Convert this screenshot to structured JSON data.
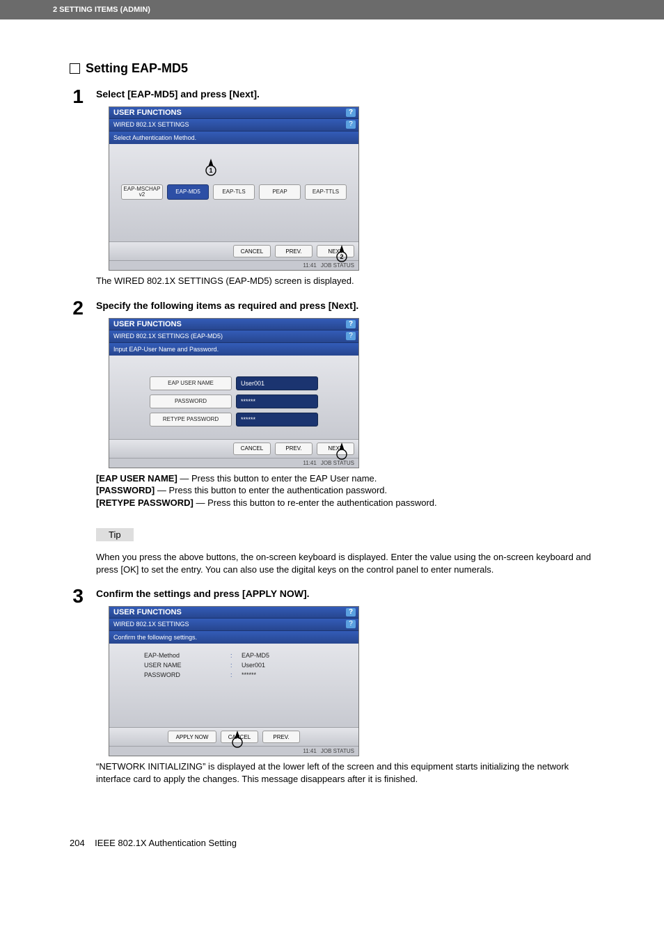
{
  "header": {
    "breadcrumb": "2 SETTING ITEMS (ADMIN)"
  },
  "section": {
    "title": "Setting EAP-MD5"
  },
  "step1": {
    "instruction": "Select [EAP-MD5] and press [Next].",
    "screenshot": {
      "titlebar": "USER FUNCTIONS",
      "subtitle": "WIRED 802.1X SETTINGS",
      "prompt": "Select Authentication Method.",
      "methods": [
        "EAP-MSCHAP v2",
        "EAP-MD5",
        "EAP-TLS",
        "PEAP",
        "EAP-TTLS"
      ],
      "selected_method": "EAP-MD5",
      "cancel": "CANCEL",
      "prev": "PREV.",
      "next": "NEXT",
      "time": "11:41",
      "jobstatus": "JOB STATUS",
      "pointer1_label": "1",
      "pointer2_label": "2"
    },
    "after": "The WIRED 802.1X SETTINGS (EAP-MD5) screen is displayed."
  },
  "step2": {
    "instruction": "Specify the following items as required and press [Next].",
    "screenshot": {
      "titlebar": "USER FUNCTIONS",
      "subtitle": "WIRED 802.1X SETTINGS (EAP-MD5)",
      "prompt": "Input EAP-User Name and Password.",
      "field_user_label": "EAP USER NAME",
      "field_user_value": "User001",
      "field_pass_label": "PASSWORD",
      "field_pass_value": "******",
      "field_repass_label": "RETYPE PASSWORD",
      "field_repass_value": "******",
      "cancel": "CANCEL",
      "prev": "PREV.",
      "next": "NEXT",
      "time": "11:41",
      "jobstatus": "JOB STATUS"
    },
    "desc": {
      "eapuser_label": "[EAP USER NAME]",
      "eapuser_text": " — Press this button to enter the EAP User name.",
      "password_label": "[PASSWORD]",
      "password_text": " — Press this button to enter the authentication password.",
      "repassword_label": "[RETYPE PASSWORD]",
      "repassword_text": " — Press this button to re-enter the authentication password."
    },
    "tip_label": "Tip",
    "tip_text": "When you press the above buttons, the on-screen keyboard is displayed. Enter the value using the on-screen keyboard and press [OK] to set the entry. You can also use the digital keys on the control panel to enter numerals."
  },
  "step3": {
    "instruction": "Confirm the settings and press [APPLY NOW].",
    "screenshot": {
      "titlebar": "USER FUNCTIONS",
      "subtitle": "WIRED 802.1X SETTINGS",
      "prompt": "Confirm the following settings.",
      "row1_label": "EAP-Method",
      "row1_value": "EAP-MD5",
      "row2_label": "USER NAME",
      "row2_value": "User001",
      "row3_label": "PASSWORD",
      "row3_value": "******",
      "apply": "APPLY NOW",
      "cancel": "CANCEL",
      "prev": "PREV.",
      "time": "11:41",
      "jobstatus": "JOB STATUS"
    },
    "after": "“NETWORK INITIALIZING” is displayed at the lower left of the screen and this equipment starts initializing the network interface card to apply the changes. This message disappears after it is finished."
  },
  "footer": {
    "page": "204",
    "title": "IEEE 802.1X Authentication Setting"
  }
}
